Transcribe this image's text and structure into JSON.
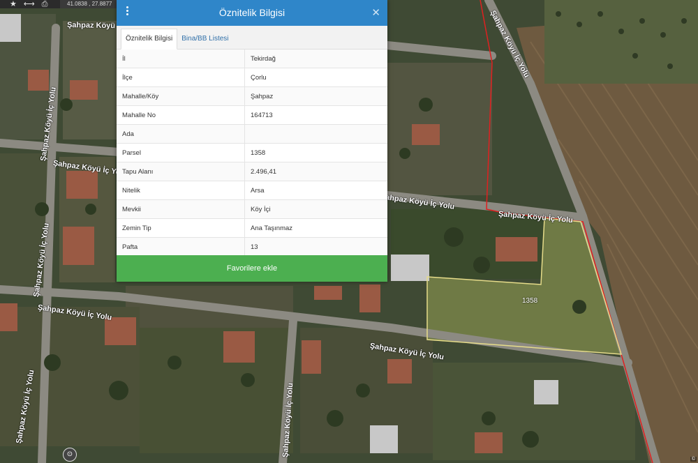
{
  "toolbar": {
    "coords": "41.0838 , 27.8877"
  },
  "map": {
    "road_labels": [
      "Şahpaz Köyü İç Yolu",
      "Şahpaz Köyü İç Yolu",
      "Şahpaz Köyü İç Yolu",
      "Şahpaz Köyü İç Yolu",
      "Şahpaz Köyü İç Yolu",
      "Şahpaz Köyü İç Yolu",
      "Şahpaz Köyü İç Yolu",
      "Şahpaz Köyü İç Yolu",
      "Şahpaz Köyü İç Yolu",
      "Şahpaz Köyü İç Yolu",
      "Şahpaz Köyü İç Yolu"
    ],
    "parcel_number": "1358",
    "parcel_outline_color": "#e6dc8a",
    "boundary_color": "#e02020"
  },
  "panel": {
    "title": "Öznitelik Bilgisi",
    "tabs": [
      "Öznitelik Bilgisi",
      "Bina/BB Listesi"
    ],
    "rows": [
      {
        "key": "İl",
        "value": "Tekirdağ"
      },
      {
        "key": "İlçe",
        "value": "Çorlu"
      },
      {
        "key": "Mahalle/Köy",
        "value": "Şahpaz"
      },
      {
        "key": "Mahalle No",
        "value": "164713"
      },
      {
        "key": "Ada",
        "value": ""
      },
      {
        "key": "Parsel",
        "value": "1358"
      },
      {
        "key": "Tapu Alanı",
        "value": "2.496,41"
      },
      {
        "key": "Nitelik",
        "value": "Arsa"
      },
      {
        "key": "Mevkii",
        "value": "Köy İçi"
      },
      {
        "key": "Zemin Tip",
        "value": "Ana Taşınmaz"
      },
      {
        "key": "Pafta",
        "value": "13"
      }
    ],
    "favorite_button": "Favorilere ekle",
    "header_color": "#2f86c9",
    "button_color": "#4caf50"
  }
}
